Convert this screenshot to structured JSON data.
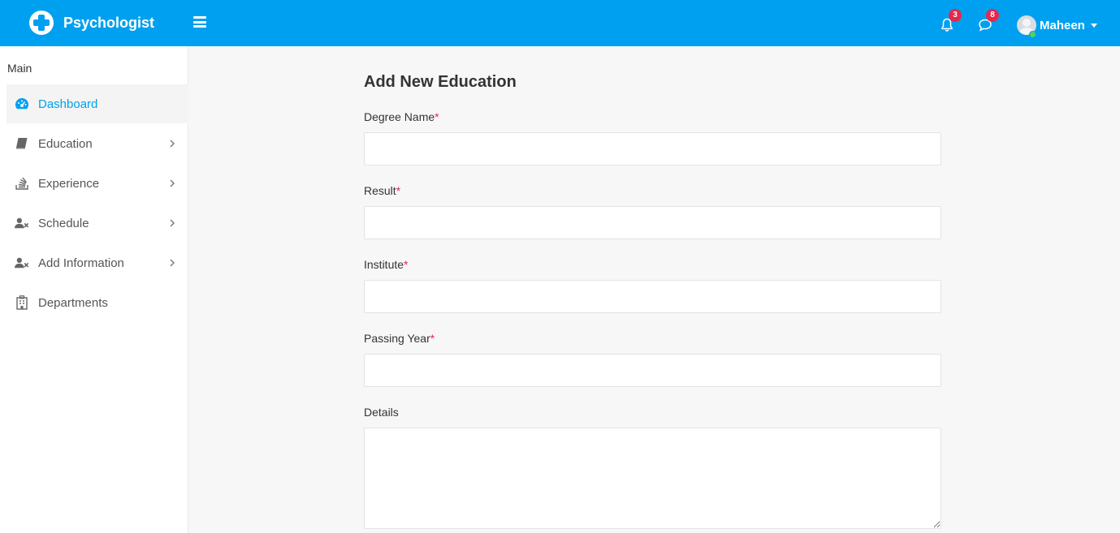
{
  "header": {
    "app_name": "Psychologist",
    "notifications_count": "3",
    "messages_count": "8",
    "user_name": "Maheen"
  },
  "sidebar": {
    "menu_title": "Main",
    "items": [
      {
        "label": "Dashboard",
        "icon": "dashboard-icon",
        "active": true
      },
      {
        "label": "Education",
        "icon": "book-icon",
        "has_submenu": true
      },
      {
        "label": "Experience",
        "icon": "stack-icon",
        "has_submenu": true
      },
      {
        "label": "Schedule",
        "icon": "user-x-icon",
        "has_submenu": true
      },
      {
        "label": "Add Information",
        "icon": "user-x-icon",
        "has_submenu": true
      },
      {
        "label": "Departments",
        "icon": "hospital-icon"
      }
    ]
  },
  "form": {
    "title": "Add New Education",
    "fields": [
      {
        "label": "Degree Name",
        "required_mark": "*",
        "value": ""
      },
      {
        "label": "Result",
        "required_mark": "*",
        "value": ""
      },
      {
        "label": "Institute",
        "required_mark": "*",
        "value": ""
      },
      {
        "label": "Passing Year",
        "required_mark": "*",
        "value": ""
      },
      {
        "label": "Details",
        "value": ""
      }
    ]
  },
  "colors": {
    "primary": "#00a0f0",
    "badge": "#e6284b",
    "online": "#55ce63"
  }
}
